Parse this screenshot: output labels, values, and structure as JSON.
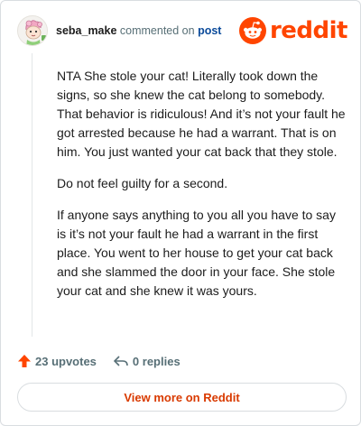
{
  "header": {
    "username": "seba_make",
    "action_text": "commented on",
    "post_link": "post",
    "logo_text": "reddit"
  },
  "comment": {
    "paragraphs": [
      "NTA She stole your cat! Literally took down the signs, so she knew the cat belong to somebody. That behavior is ridiculous! And it’s not your fault he got arrested because he had a warrant. That is on him. You just wanted your cat back that they stole.",
      "Do not feel guilty for a second.",
      "If anyone says anything to you all you have to say is it’s not your fault he had a warrant in the first place. You went to her house to get your cat back and she slammed the door in your face. She stole your cat and she knew it was yours."
    ]
  },
  "footer": {
    "upvotes": "23 upvotes",
    "replies": "0 replies"
  },
  "view_more": "View more on Reddit",
  "colors": {
    "brand": "#ff4500",
    "link": "#0a4a9a",
    "muted": "#576f76"
  },
  "icons": {
    "avatar": "cartoon-avatar",
    "logo": "reddit-snoo-icon",
    "upvote": "upvote-arrow-icon",
    "reply": "reply-arrow-icon"
  }
}
